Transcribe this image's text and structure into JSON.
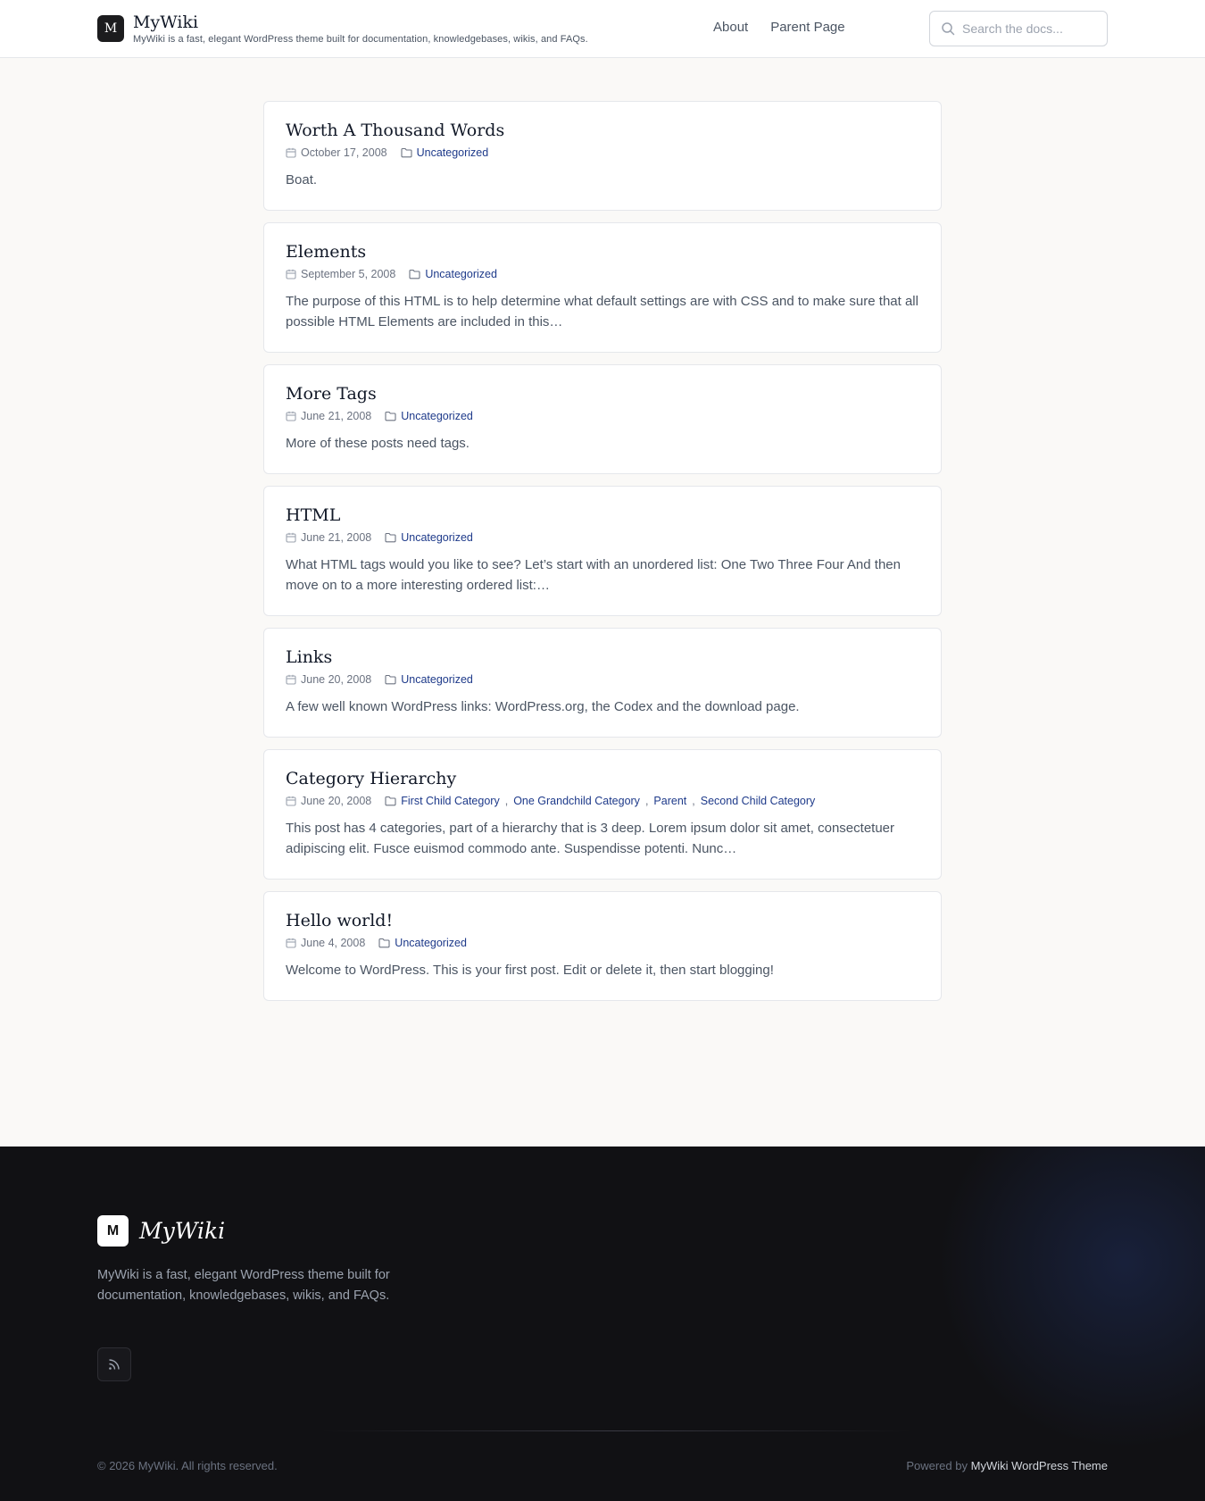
{
  "header": {
    "logo_letter": "M",
    "site_name": "MyWiki",
    "tagline": "MyWiki is a fast, elegant WordPress theme built for documentation, knowledgebases, wikis, and FAQs.",
    "nav": [
      {
        "label": "About"
      },
      {
        "label": "Parent Page"
      }
    ],
    "search_placeholder": "Search the docs..."
  },
  "posts": [
    {
      "title": "Worth A Thousand Words",
      "date": "October 17, 2008",
      "categories": [
        "Uncategorized"
      ],
      "excerpt": "Boat."
    },
    {
      "title": "Elements",
      "date": "September 5, 2008",
      "categories": [
        "Uncategorized"
      ],
      "excerpt": "The purpose of this HTML is to help determine what default settings are with CSS and to make sure that all possible HTML Elements are included in this…"
    },
    {
      "title": "More Tags",
      "date": "June 21, 2008",
      "categories": [
        "Uncategorized"
      ],
      "excerpt": "More of these posts need tags."
    },
    {
      "title": "HTML",
      "date": "June 21, 2008",
      "categories": [
        "Uncategorized"
      ],
      "excerpt": "What HTML tags would you like to see? Let’s start with an unordered list: One Two Three Four And then move on to a more interesting ordered list:…"
    },
    {
      "title": "Links",
      "date": "June 20, 2008",
      "categories": [
        "Uncategorized"
      ],
      "excerpt": "A few well known WordPress links: WordPress.org, the Codex and the download page."
    },
    {
      "title": "Category Hierarchy",
      "date": "June 20, 2008",
      "categories": [
        "First Child Category",
        "One Grandchild Category",
        "Parent",
        "Second Child Category"
      ],
      "excerpt": "This post has 4 categories, part of a hierarchy that is 3 deep. Lorem ipsum dolor sit amet, consectetuer adipiscing elit. Fusce euismod commodo ante. Suspendisse potenti. Nunc…"
    },
    {
      "title": "Hello world!",
      "date": "June 4, 2008",
      "categories": [
        "Uncategorized"
      ],
      "excerpt": "Welcome to WordPress. This is your first post. Edit or delete it, then start blogging!"
    }
  ],
  "footer": {
    "logo_letter": "M",
    "site_name": "MyWiki",
    "description": "MyWiki is a fast, elegant WordPress theme built for documentation, knowledgebases, wikis, and FAQs.",
    "rss_icon": "rss-icon",
    "copyright": "© 2026 MyWiki. All rights reserved.",
    "powered_prefix": "Powered by",
    "powered_link": "MyWiki WordPress Theme"
  },
  "colors": {
    "page_bg": "#faf9f7",
    "footer_bg": "#111114",
    "link": "#1e3a8a",
    "logo_bg": "#1c1c1e"
  }
}
